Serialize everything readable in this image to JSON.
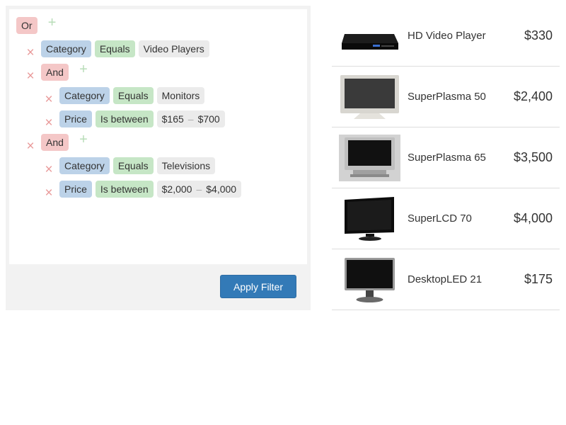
{
  "filter": {
    "root_logic": "Or",
    "conditions": [
      {
        "field": "Category",
        "op": "Equals",
        "value": "Video Players"
      }
    ],
    "groups": [
      {
        "logic": "And",
        "conditions": [
          {
            "field": "Category",
            "op": "Equals",
            "value": "Monitors"
          },
          {
            "field": "Price",
            "op": "Is between",
            "from": "$165",
            "sep": "–",
            "to": "$700"
          }
        ]
      },
      {
        "logic": "And",
        "conditions": [
          {
            "field": "Category",
            "op": "Equals",
            "value": "Televisions"
          },
          {
            "field": "Price",
            "op": "Is between",
            "from": "$2,000",
            "sep": "–",
            "to": "$4,000"
          }
        ]
      }
    ],
    "apply_label": "Apply Filter",
    "remove_icon": "×",
    "add_icon": "+"
  },
  "products": [
    {
      "name": "HD Video Player",
      "price": "$330",
      "image": "video-player-image"
    },
    {
      "name": "SuperPlasma 50",
      "price": "$2,400",
      "image": "plasma-tv-image"
    },
    {
      "name": "SuperPlasma 65",
      "price": "$3,500",
      "image": "plasma-tv-silver-image"
    },
    {
      "name": "SuperLCD 70",
      "price": "$4,000",
      "image": "lcd-tv-image"
    },
    {
      "name": "DesktopLED 21",
      "price": "$175",
      "image": "desktop-monitor-image"
    }
  ],
  "colors": {
    "logic_pill": "#f4c7c7",
    "field_pill": "#bcd2e8",
    "op_pill": "#c6e6c6",
    "value_pill": "#ebebeb",
    "apply_button": "#337ab7"
  }
}
